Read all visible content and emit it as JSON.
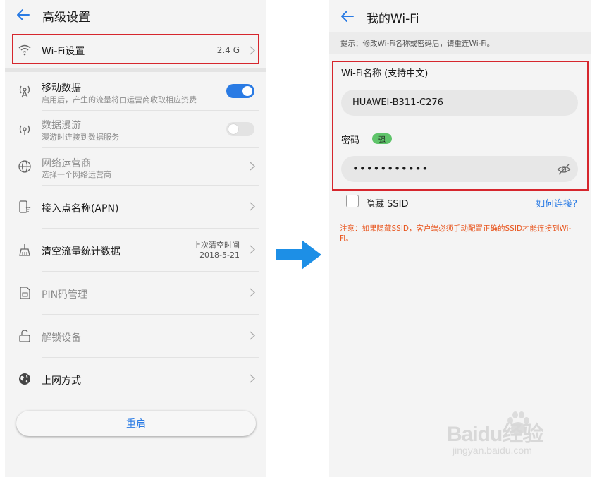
{
  "colors": {
    "accent": "#2a7be4",
    "red_frame": "#d6262d",
    "warning_text": "#e8541c",
    "toggle_on": "#2a7be4",
    "toggle_off": "#e3e3e3",
    "badge_strong": "#5fc46a",
    "arrow": "#1d8fe6"
  },
  "left": {
    "header": {
      "title": "高级设置",
      "back_icon": "arrow-left-icon"
    },
    "wifi": {
      "title": "Wi-Fi设置",
      "value": "2.4 G",
      "icon": "wifi-icon"
    },
    "mobile_data": {
      "title": "移动数据",
      "subtitle": "启用后，产生的流量将由运营商收取相应资费",
      "icon": "antenna-icon",
      "enabled": true
    },
    "roaming": {
      "title": "数据漫游",
      "subtitle": "漫游时连接到数据服务",
      "icon": "roaming-icon",
      "enabled": false
    },
    "carrier": {
      "title": "网络运营商",
      "subtitle": "选择一个网络运营商",
      "icon": "globe-icon"
    },
    "apn": {
      "title": "接入点名称(APN)",
      "icon": "apn-icon"
    },
    "clear_stats": {
      "title": "清空流量统计数据",
      "value_line1": "上次清空时间",
      "value_line2": "2018-5-21",
      "icon": "broom-icon"
    },
    "pin": {
      "title": "PIN码管理",
      "icon": "sim-card-icon"
    },
    "unlock": {
      "title": "解锁设备",
      "icon": "unlock-icon"
    },
    "internet_mode": {
      "title": "上网方式",
      "icon": "earth-icon"
    },
    "restart_label": "重启"
  },
  "right": {
    "header": {
      "title": "我的Wi-Fi",
      "back_icon": "arrow-left-icon"
    },
    "hint": "提示：修改Wi-Fi名称或密码后，请重连Wi-Fi。",
    "ssid_label": "Wi-Fi名称 (支持中文)",
    "ssid_value": "HUAWEI-B311-C276",
    "password_label": "密码",
    "password_strength": "强",
    "password_value": "•••••••••••",
    "eye_icon": "eye-off-icon",
    "hide_ssid_label": "隐藏 SSID",
    "hide_ssid_checked": false,
    "how_to_connect": "如何连接?",
    "warning": "注意：如果隐藏SSID，客户端必须手动配置正确的SSID才能连接到Wi-Fi。"
  },
  "watermark": {
    "logo": "Baidu经验",
    "sub": "jingyan.baidu.com"
  }
}
